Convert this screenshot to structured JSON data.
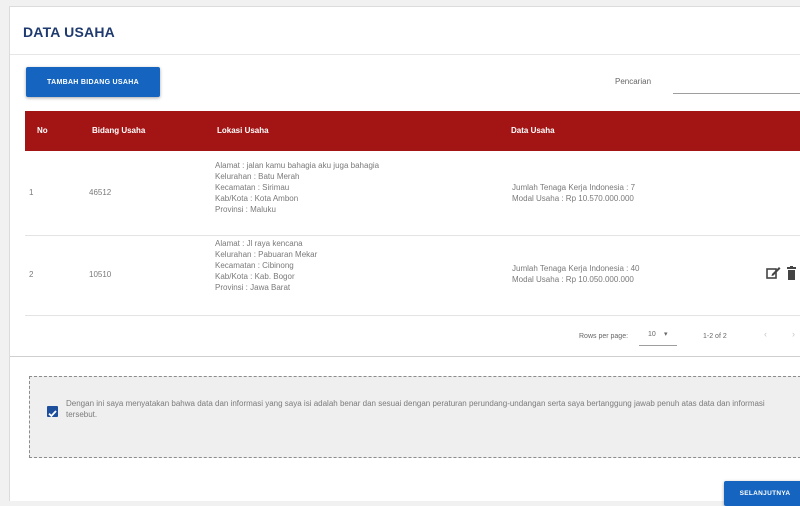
{
  "page": {
    "title": "DATA USAHA"
  },
  "toolbar": {
    "add_button_label": "TAMBAH BIDANG USAHA",
    "search_label": "Pencarian",
    "search_value": ""
  },
  "table": {
    "headers": [
      "No",
      "Bidang Usaha",
      "Lokasi Usaha",
      "Data Usaha"
    ],
    "rows": [
      {
        "no": "1",
        "bidang": "46512",
        "lokasi": [
          "Alamat : jalan kamu bahagia aku juga bahagia",
          "Kelurahan : Batu Merah",
          "Kecamatan : Sirimau",
          "Kab/Kota : Kota Ambon",
          "Provinsi : Maluku"
        ],
        "data": [
          "Jumlah Tenaga Kerja Indonesia : 7",
          "Modal Usaha : Rp 10.570.000.000"
        ]
      },
      {
        "no": "2",
        "bidang": "10510",
        "lokasi": [
          "Alamat : Jl raya kencana",
          "Kelurahan : Pabuaran Mekar",
          "Kecamatan : Cibinong",
          "Kab/Kota : Kab. Bogor",
          "Provinsi : Jawa Barat"
        ],
        "data": [
          "Jumlah Tenaga Kerja Indonesia : 40",
          "Modal Usaha : Rp 10.050.000.000"
        ],
        "actions": [
          "edit-icon",
          "delete-icon"
        ]
      }
    ]
  },
  "pagination": {
    "rows_per_page_label": "Rows per page:",
    "rows_per_page_value": "10",
    "range": "1-2 of 2"
  },
  "declaration": {
    "checked": true,
    "text": "Dengan ini saya menyatakan bahwa data dan informasi yang saya isi adalah benar dan sesuai dengan peraturan perundang-undangan serta saya bertanggung jawab penuh atas data dan informasi tersebut."
  },
  "footer": {
    "next_button_label": "SELANJUTNYA"
  },
  "colors": {
    "primary": "#1565c0",
    "header_red": "#a31515",
    "title_navy": "#1f3a6e",
    "checkbox": "#1e4f9c"
  }
}
